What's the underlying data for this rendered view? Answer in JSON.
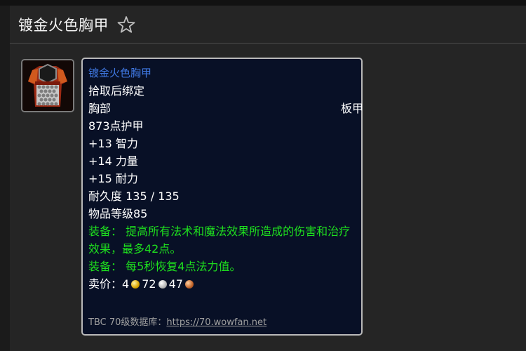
{
  "header": {
    "title": "镀金火色胸甲",
    "favorite_icon": "star-outline-icon"
  },
  "item": {
    "icon_name": "fire-chestplate-icon",
    "name": "镀金火色胸甲",
    "binding": "拾取后绑定",
    "slot": "胸部",
    "armor_type": "板甲",
    "armor": "873点护甲",
    "stats": [
      "+13 智力",
      "+14 力量",
      "+15 耐力"
    ],
    "durability": "耐久度 135 / 135",
    "item_level": "物品等级85",
    "equip_effects": [
      "装备：  提高所有法术和魔法效果所造成的伤害和治疗效果，最多42点。",
      "装备：  每5秒恢复4点法力值。"
    ],
    "price": {
      "label": "卖价：",
      "gold": "4",
      "silver": "72",
      "copper": "47"
    }
  },
  "footer": {
    "source_label": "TBC 70级数据库：",
    "source_link": "https://70.wowfan.net"
  },
  "colors": {
    "background": "#252525",
    "tooltip_bg": "#081026",
    "item_name": "#3f77e0",
    "equip_green": "#1ee01e"
  }
}
